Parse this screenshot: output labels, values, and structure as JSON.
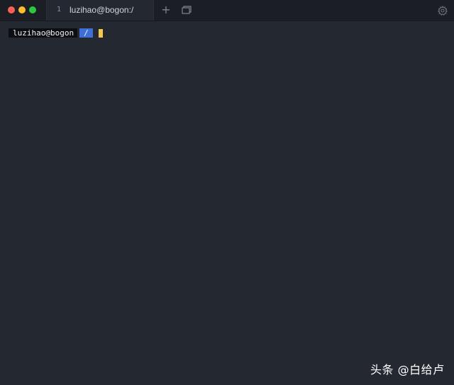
{
  "tab": {
    "index": "1",
    "title": "luzihao@bogon:/"
  },
  "toolbar": {
    "new_tab_glyph": "+",
    "icons": [
      "plus-icon",
      "split-window-icon",
      "gear-icon"
    ]
  },
  "terminal": {
    "prompt_user": "luzihao@bogon",
    "prompt_path": "/",
    "cursor_color": "#f2c94c"
  },
  "watermark": {
    "text": "头条 @白给卢"
  },
  "colors": {
    "background": "#232831",
    "titlebar": "#1b1f25",
    "path_segment": "#3e6fd8",
    "close": "#fe5f57",
    "minimize": "#febc2e",
    "maximize": "#28c840"
  }
}
